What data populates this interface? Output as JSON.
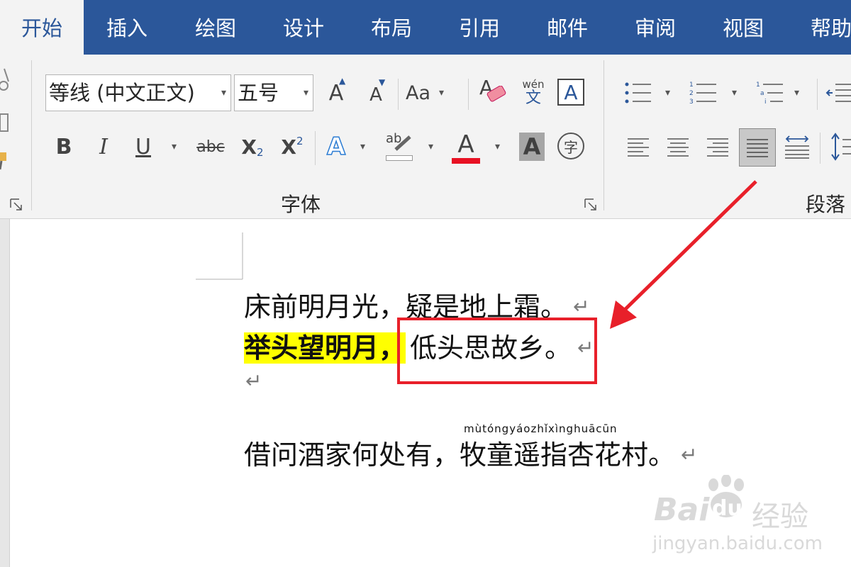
{
  "tabs": [
    {
      "label": "开始",
      "active": true
    },
    {
      "label": "插入"
    },
    {
      "label": "绘图"
    },
    {
      "label": "设计"
    },
    {
      "label": "布局"
    },
    {
      "label": "引用"
    },
    {
      "label": "邮件"
    },
    {
      "label": "审阅"
    },
    {
      "label": "视图"
    },
    {
      "label": "帮助"
    }
  ],
  "font_group": {
    "font_name": "等线 (中文正文)",
    "font_size": "五号",
    "grow_font": "A",
    "shrink_font": "A",
    "change_case": "Aa",
    "clear_format": "A",
    "pinyin_top": "wén",
    "pinyin_char": "文",
    "char_border": "A",
    "bold": "B",
    "italic": "I",
    "underline": "U",
    "strikethrough": "abc",
    "subscript": "X",
    "subscript_sub": "2",
    "superscript": "X",
    "superscript_sup": "2",
    "text_effect": "A",
    "highlight": "ab",
    "font_color": "A",
    "char_shading": "A",
    "enclose_char": "字",
    "label": "字体",
    "font_color_bar": "#e81123"
  },
  "paragraph_group": {
    "label": "段落"
  },
  "document": {
    "line1": "床前明月光，疑是地上霜。",
    "line2_highlighted": "举头望明月，",
    "line2_rest": "低头思故乡。",
    "line4": "借问酒家何处有，牧童遥指杏花村。",
    "pinyin": "mùtóngyáozhǐxìnghuācūn",
    "para_mark": "↵"
  },
  "annotation": {
    "color": "#e8202a"
  },
  "watermark": {
    "logo_text": "Bai",
    "logo_text2": "du",
    "brand": "经验",
    "url": "jingyan.baidu.com"
  },
  "colors": {
    "tab_bar": "#2b579a",
    "ribbon": "#f3f3f3",
    "highlight": "#ffff00"
  }
}
